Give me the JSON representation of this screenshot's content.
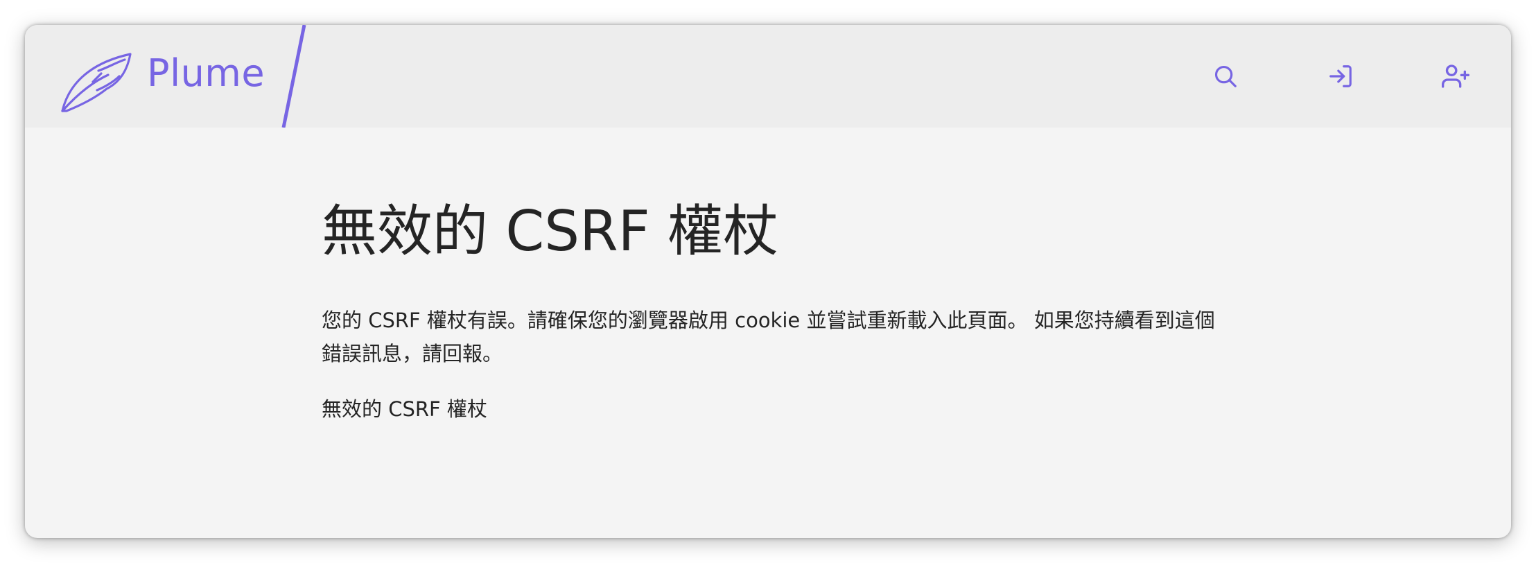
{
  "header": {
    "brand": "Plume",
    "icons": {
      "logo": "feather-icon",
      "search": "search-icon",
      "login": "login-icon",
      "signup": "user-plus-icon"
    },
    "accent_color": "#7765e3"
  },
  "main": {
    "title": "無效的 CSRF 權杖",
    "message": "您的 CSRF 權杖有誤。請確保您的瀏覽器啟用 cookie 並嘗試重新載入此頁面。 如果您持續看到這個錯誤訊息，請回報。",
    "error_detail": "無效的 CSRF 權杖"
  }
}
